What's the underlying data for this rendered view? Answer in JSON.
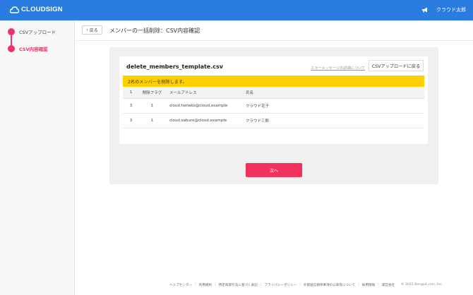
{
  "app": {
    "logo_text": "CLOUDSIGN",
    "user_name": "クラウド太郎"
  },
  "sidebar": {
    "steps": [
      {
        "label": "CSVアップロード"
      },
      {
        "label": "CSV内容確認"
      }
    ]
  },
  "header": {
    "back_label": "戻る",
    "title": "メンバーの一括削除：CSV内容確認"
  },
  "card": {
    "filename": "delete_members_template.csv",
    "error_link": "エラーメッセージの詳細について",
    "return_button": "CSVアップロードに戻る",
    "notice": "2名のメンバーを削除します。"
  },
  "table": {
    "headers": [
      "1",
      "削除フラグ",
      "メールアドレス",
      "氏名"
    ],
    "rows": [
      [
        "3",
        "1",
        "cloud.hanako@cloud.example",
        "クラウド花子"
      ],
      [
        "3",
        "1",
        "cloud.saburo@cloud.example",
        "クラウド三郎"
      ]
    ]
  },
  "actions": {
    "next_label": "次へ"
  },
  "footer": {
    "links": [
      "ヘルプセンター",
      "利用規約",
      "特定商取引法に基づく表記",
      "プライバシーポリシー",
      "外部送信規律事項の公表等について",
      "採用情報",
      "運営会社"
    ],
    "copyright": "© 2015 Bengo4.com, Inc."
  },
  "colors": {
    "primary": "#2b7ce0",
    "accent": "#ee3366",
    "notice": "#ffd000",
    "next_button": "#f0325c"
  }
}
